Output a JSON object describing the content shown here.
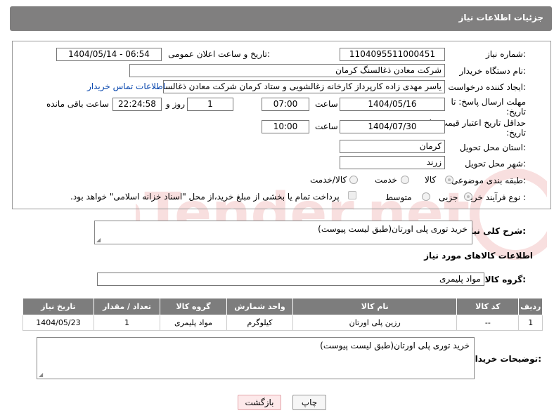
{
  "header": {
    "title": "جزئیات اطلاعات نیاز"
  },
  "form": {
    "need_number_label": "شماره نیاز:",
    "need_number": "1104095511000451",
    "announce_label": "تاریخ و ساعت اعلان عمومی:",
    "announce_value": "1404/05/14 - 06:54",
    "buyer_org_label": "نام دستگاه خریدار:",
    "buyer_org": "شرکت معادن ذغالسنگ کرمان",
    "creator_label": "ایجاد کننده درخواست:",
    "creator": "یاسر مهدی زاده کارپرداز کارخانه زغالشویی و ستاد کرمان شرکت معادن ذغالسنگ کرمان",
    "contact_link": "اطلاعات تماس خریدار",
    "reply_deadline_label": "مهلت ارسال پاسخ: تا تاریخ:",
    "reply_date": "1404/05/16",
    "time_label": "ساعت",
    "reply_time": "07:00",
    "days_value": "1",
    "days_label": "روز و",
    "remaining_time": "22:24:58",
    "remaining_label": "ساعت باقی مانده",
    "price_deadline_label": "حداقل تاریخ اعتبار قیمت: تا تاریخ:",
    "price_date": "1404/07/30",
    "price_time": "10:00",
    "province_label": "استان محل تحویل:",
    "province": "کرمان",
    "city_label": "شهر محل تحویل:",
    "city": "زرند",
    "category_label": "طبقه بندی موضوعی:",
    "category_options": [
      "کالا",
      "خدمت",
      "کالا/خدمت"
    ],
    "process_label": "نوع فرآیند خرید :",
    "process_options": [
      "جزیی",
      "متوسط"
    ],
    "payment_note": "پرداخت تمام یا بخشی از مبلغ خرید،از محل \"اسناد خزانه اسلامی\" خواهد بود."
  },
  "description": {
    "label": "شرح کلی نیاز:",
    "value": "خرید توری پلی اورتان(طبق لیست پیوست)"
  },
  "goods": {
    "section_title": "اطلاعات کالاهای مورد نیاز",
    "group_label": "گروه کالا:",
    "group_value": "مواد پلیمری",
    "columns": [
      "ردیف",
      "کد کالا",
      "نام کالا",
      "واحد شمارش",
      "گروه کالا",
      "تعداد / مقدار",
      "تاریخ نیاز"
    ],
    "rows": [
      [
        "1",
        "--",
        "رزین پلی اورتان",
        "کیلوگرم",
        "مواد پلیمری",
        "1",
        "1404/05/23"
      ]
    ]
  },
  "buyer_notes": {
    "label": "توضیحات خریدار:",
    "value": "خرید توری پلی اورتان(طبق لیست پیوست)"
  },
  "buttons": {
    "print": "چاپ",
    "back": "بازگشت"
  },
  "watermark": {
    "brand": "AriaTender.net"
  }
}
